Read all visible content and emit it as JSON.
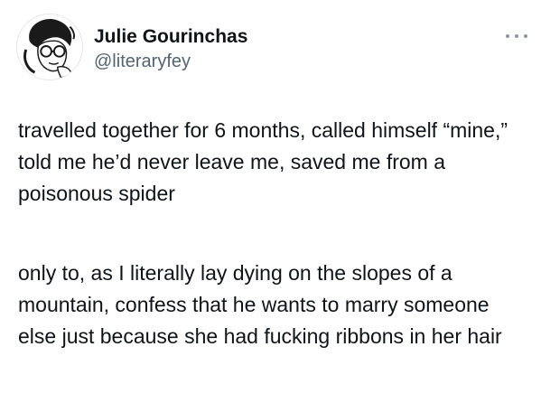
{
  "author": {
    "display_name": "Julie Gourinchas",
    "handle": "@literaryfey"
  },
  "tweet": {
    "paragraphs": [
      "travelled together for 6 months, called himself “mine,” told me he’d never leave me, saved me from a poisonous spider",
      "only to, as I literally lay dying on the slopes of a mountain, confess that he wants to marry someone else just because she had fucking ribbons in her hair"
    ]
  },
  "icons": {
    "more": "more-options-icon",
    "avatar": "profile-avatar"
  }
}
